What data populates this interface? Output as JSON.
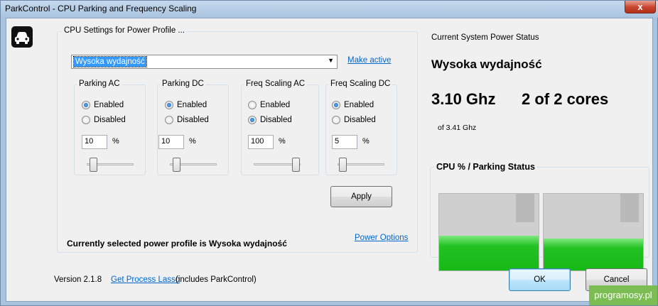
{
  "window": {
    "title": "ParkControl - CPU Parking and Frequency Scaling",
    "close_symbol": "x"
  },
  "settings": {
    "group_label": "CPU Settings for Power Profile ...",
    "profile_selected": "Wysoka wydajność",
    "make_active": "Make active",
    "apply": "Apply",
    "current_profile_text": "Currently selected power profile is Wysoka wydajność",
    "power_options": "Power Options",
    "panels": [
      {
        "title": "Parking AC",
        "enabled_label": "Enabled",
        "disabled_label": "Disabled",
        "selected": "Enabled",
        "value": "10",
        "pct": "%",
        "slider_fraction": 0.1
      },
      {
        "title": "Parking DC",
        "enabled_label": "Enabled",
        "disabled_label": "Disabled",
        "selected": "Enabled",
        "value": "10",
        "pct": "%",
        "slider_fraction": 0.1
      },
      {
        "title": "Freq Scaling AC",
        "enabled_label": "Enabled",
        "disabled_label": "Disabled",
        "selected": "Disabled",
        "value": "100",
        "pct": "%",
        "slider_fraction": 1.0
      },
      {
        "title": "Freq Scaling DC",
        "enabled_label": "Enabled",
        "disabled_label": "Disabled",
        "selected": "Enabled",
        "value": "5",
        "pct": "%",
        "slider_fraction": 0.05
      }
    ]
  },
  "status": {
    "heading": "Current System Power Status",
    "profile": "Wysoka wydajność",
    "frequency": "3.10 Ghz",
    "cores": "2 of 2 cores",
    "max_freq": "of 3.41 Ghz",
    "cpu_label": "CPU % / Parking Status",
    "cores_fill": [
      0.45,
      0.42
    ]
  },
  "footer": {
    "version": "Version 2.1.8",
    "lasso_link": "Get Process Lasso",
    "lasso_suffix": "(includes ParkControl)",
    "ok": "OK",
    "cancel": "Cancel"
  },
  "watermark": "programosy.pl",
  "colors": {
    "accent": "#3399ff",
    "link": "#0066cc",
    "meter_green": "#17b917"
  }
}
